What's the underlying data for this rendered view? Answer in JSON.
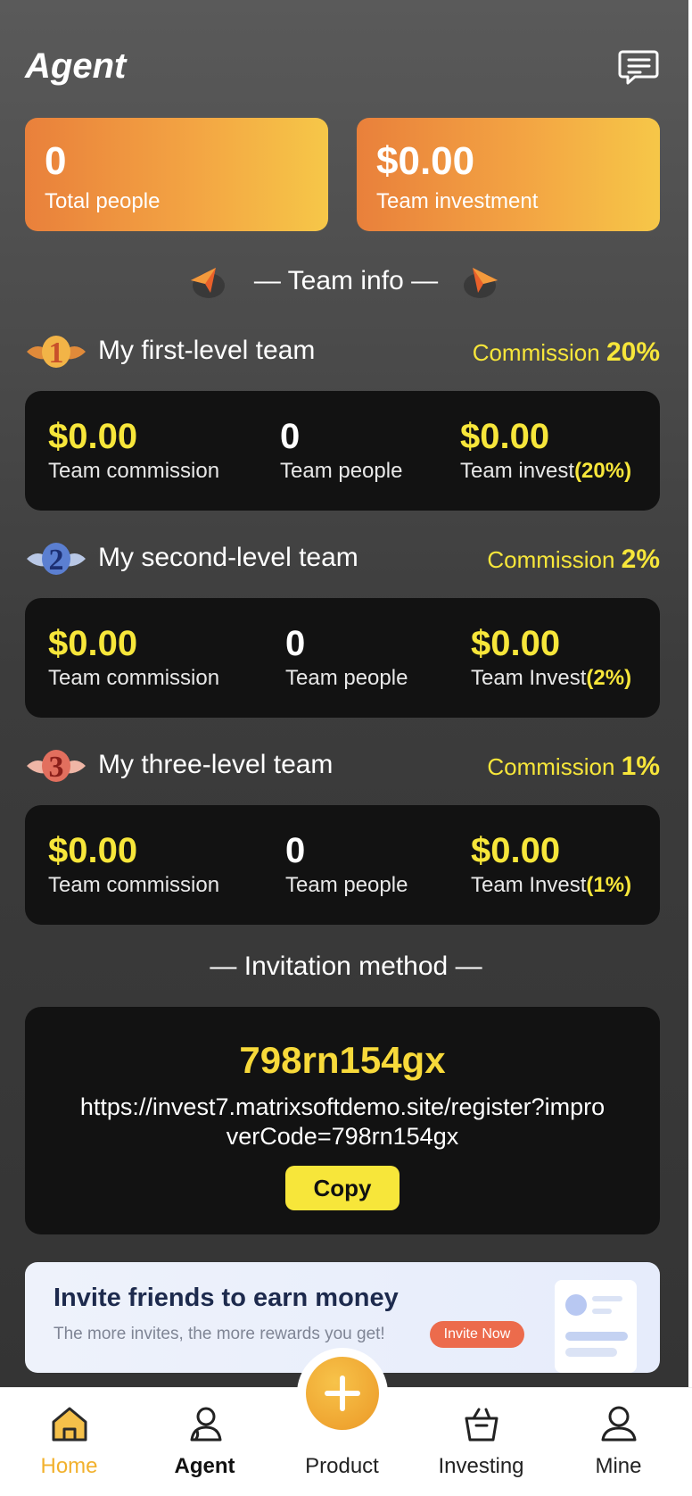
{
  "header": {
    "title": "Agent",
    "message_icon": "message-icon"
  },
  "stats": {
    "total_people": {
      "value": "0",
      "label": "Total people"
    },
    "team_investment": {
      "value": "$0.00",
      "label": "Team investment"
    }
  },
  "team_info": {
    "title": "— Team info —"
  },
  "levels": [
    {
      "title": "My first-level team",
      "commission_label": "Commission",
      "commission_value": "20%",
      "commission_amount": "$0.00",
      "commission_caption": "Team commission",
      "people": "0",
      "people_caption": "Team people",
      "invest": "$0.00",
      "invest_caption": "Team invest",
      "invest_pct": "(20%)"
    },
    {
      "title": "My second-level team",
      "commission_label": "Commission",
      "commission_value": "2%",
      "commission_amount": "$0.00",
      "commission_caption": "Team commission",
      "people": "0",
      "people_caption": "Team people",
      "invest": "$0.00",
      "invest_caption": "Team Invest",
      "invest_pct": "(2%)"
    },
    {
      "title": "My three-level team",
      "commission_label": "Commission",
      "commission_value": "1%",
      "commission_amount": "$0.00",
      "commission_caption": "Team commission",
      "people": "0",
      "people_caption": "Team people",
      "invest": "$0.00",
      "invest_caption": "Team Invest",
      "invest_pct": "(1%)"
    }
  ],
  "invitation": {
    "title": "— Invitation method —",
    "code": "798rn154gx",
    "link": "https://invest7.matrixsoftdemo.site/register?improverCode=798rn154gx",
    "copy_label": "Copy"
  },
  "banner": {
    "title": "Invite friends to earn money",
    "subtitle": "The more invites, the more rewards you get!",
    "button_label": "Invite Now"
  },
  "tabs": [
    {
      "label": "Home",
      "icon": "home-icon"
    },
    {
      "label": "Agent",
      "icon": "agent-icon"
    },
    {
      "label": "Product",
      "icon": "plus-icon"
    },
    {
      "label": "Investing",
      "icon": "basket-icon"
    },
    {
      "label": "Mine",
      "icon": "person-icon"
    }
  ],
  "colors": {
    "accent_yellow": "#f7e63a",
    "card_orange_start": "#e9803b",
    "card_orange_end": "#f6c748",
    "active_tab": "#f2b12d"
  }
}
